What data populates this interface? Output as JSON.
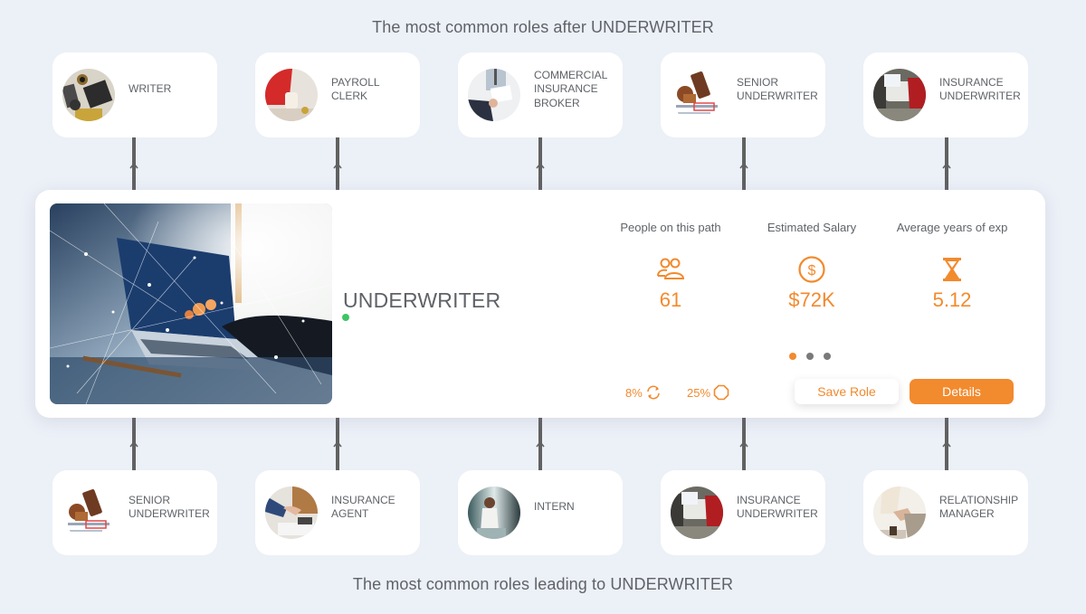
{
  "titles": {
    "after": "The most common roles after UNDERWRITER",
    "before": "The most common roles leading to UNDERWRITER"
  },
  "roles_after": [
    {
      "label": "WRITER",
      "image": "writer-desk-photo"
    },
    {
      "label": "PAYROLL\nCLERK",
      "image": "payroll-clerk-photo"
    },
    {
      "label": "COMMERCIAL\nINSURANCE\nBROKER",
      "image": "broker-meeting-photo"
    },
    {
      "label": "SENIOR\nUNDERWRITER",
      "image": "stamp-photo"
    },
    {
      "label": "INSURANCE\nUNDERWRITER",
      "image": "car-inspection-photo"
    }
  ],
  "roles_before": [
    {
      "label": "SENIOR\nUNDERWRITER",
      "image": "stamp-photo"
    },
    {
      "label": "INSURANCE\nAGENT",
      "image": "handshake-photo"
    },
    {
      "label": "INTERN",
      "image": "intern-window-photo"
    },
    {
      "label": "INSURANCE\nUNDERWRITER",
      "image": "car-inspection-photo"
    },
    {
      "label": "RELATIONSHIP\nMANAGER",
      "image": "relationship-photo"
    }
  ],
  "main": {
    "role_title": "UNDERWRITER",
    "hero_image": "laptop-network-photo",
    "status_color": "#3ec565",
    "stats": [
      {
        "label": "People on this path",
        "icon": "people-icon",
        "value": "61"
      },
      {
        "label": "Estimated Salary",
        "icon": "dollar-circle-icon",
        "value": "$72K"
      },
      {
        "label": "Average years of exp",
        "icon": "hourglass-icon",
        "value": "5.12"
      }
    ],
    "carousel": {
      "total": 3,
      "active": 1
    },
    "metrics": [
      {
        "value": "8%",
        "icon": "refresh-cycle-icon"
      },
      {
        "value": "25%",
        "icon": "octagon-icon"
      }
    ],
    "save_label": "Save Role",
    "details_label": "Details"
  },
  "colors": {
    "accent": "#f28a2e",
    "background": "#ecf0f7",
    "text": "#5f6368",
    "connector": "#616161"
  }
}
